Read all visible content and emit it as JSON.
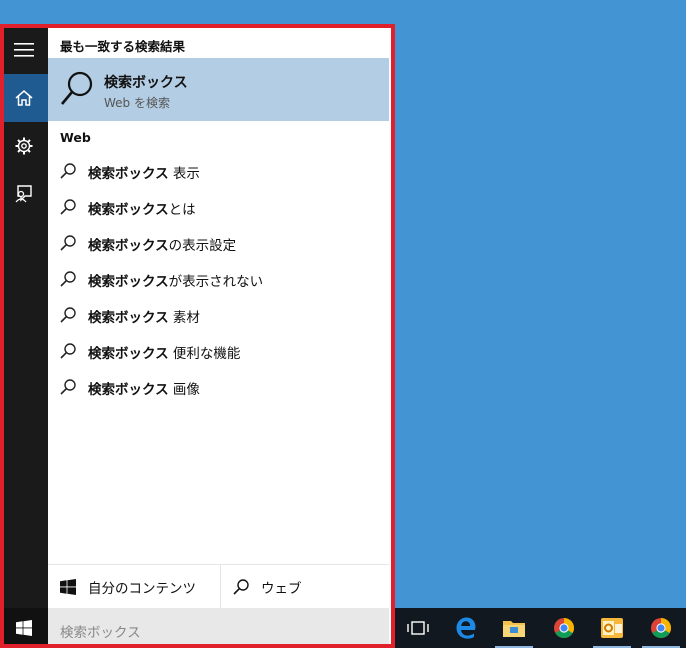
{
  "colors": {
    "accent": "#1f5a91",
    "highlight": "#b3cde4",
    "frame": "#e0202b",
    "desktop": "#4294d3"
  },
  "rail": {
    "items": [
      {
        "icon": "hamburger-menu-icon"
      },
      {
        "icon": "home-icon"
      },
      {
        "icon": "gear-icon"
      },
      {
        "icon": "feedback-icon"
      }
    ]
  },
  "best_match": {
    "heading": "最も一致する検索結果",
    "title": "検索ボックス",
    "subtitle": "Web を検索"
  },
  "web": {
    "heading": "Web",
    "items": [
      {
        "bold": "検索ボックス",
        "rest": " 表示"
      },
      {
        "bold": "検索ボックス",
        "rest": "とは"
      },
      {
        "bold": "検索ボックス",
        "rest": "の表示設定"
      },
      {
        "bold": "検索ボックス",
        "rest": "が表示されない"
      },
      {
        "bold": "検索ボックス",
        "rest": " 素材"
      },
      {
        "bold": "検索ボックス",
        "rest": " 便利な機能"
      },
      {
        "bold": "検索ボックス",
        "rest": " 画像"
      }
    ]
  },
  "tabs": {
    "mine": "自分のコンテンツ",
    "web": "ウェブ"
  },
  "search": {
    "placeholder": "検索ボックス"
  },
  "taskbar": {
    "items": [
      {
        "icon": "task-view-icon"
      },
      {
        "icon": "edge-icon"
      },
      {
        "icon": "file-explorer-icon"
      },
      {
        "icon": "chrome-icon"
      },
      {
        "icon": "outlook-icon"
      },
      {
        "icon": "chrome-icon"
      }
    ]
  }
}
